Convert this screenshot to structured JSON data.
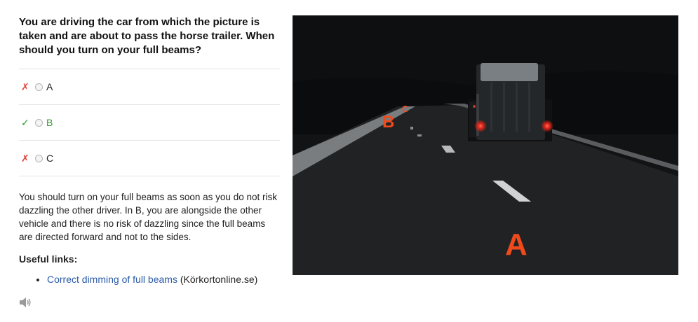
{
  "question": "You are driving the car from which the picture is taken and are about to pass the horse trailer. When should you turn on your full beams?",
  "options": [
    {
      "status": "wrong",
      "mark": "✗",
      "label": "A"
    },
    {
      "status": "correct",
      "mark": "✓",
      "label": "B"
    },
    {
      "status": "wrong",
      "mark": "✗",
      "label": "C"
    }
  ],
  "explanation": "You should turn on your full beams as soon as you do not risk dazzling the other driver. In B, you are alongside the other vehicle and there is no risk of dazzling since the full beams are directed forward and not to the sides.",
  "useful_links": {
    "title": "Useful links:",
    "items": [
      {
        "link_text": "Correct dimming of full beams",
        "source": "(Körkortonline.se)"
      }
    ]
  },
  "audio_icon": "speaker-icon",
  "image": {
    "markers": {
      "a": "A",
      "b": "B",
      "c": "C"
    }
  },
  "colors": {
    "wrong": "#e0443e",
    "correct": "#3a9a3a",
    "link": "#2a5aa8",
    "marker": "#f04a1c"
  }
}
